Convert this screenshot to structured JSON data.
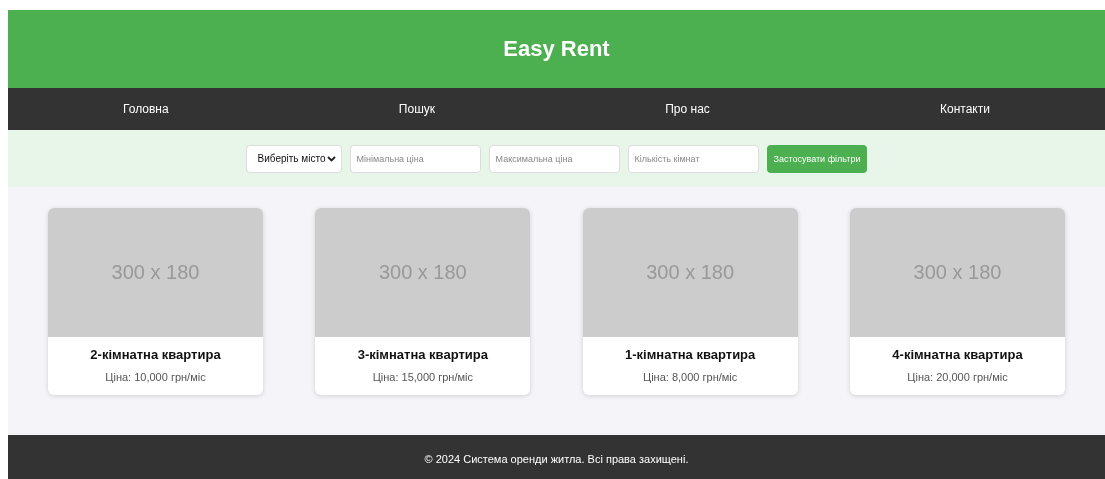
{
  "header": {
    "title": "Easy Rent"
  },
  "nav": [
    {
      "label": "Головна"
    },
    {
      "label": "Пошук"
    },
    {
      "label": "Про нас"
    },
    {
      "label": "Контакти"
    }
  ],
  "filters": {
    "city": {
      "value": "Виберіть місто"
    },
    "inputs": [
      {
        "placeholder": "Мінімальна ціна"
      },
      {
        "placeholder": "Максимальна ціна"
      },
      {
        "placeholder": "Кількість кімнат"
      }
    ],
    "button": "Застосувати фільтри"
  },
  "listings": [
    {
      "image_label": "300 x 180",
      "title": "2-кімнатна квартира",
      "price": "Ціна: 10,000 грн/міс"
    },
    {
      "image_label": "300 x 180",
      "title": "3-кімнатна квартира",
      "price": "Ціна: 15,000 грн/міс"
    },
    {
      "image_label": "300 x 180",
      "title": "1-кімнатна квартира",
      "price": "Ціна: 8,000 грн/міс"
    },
    {
      "image_label": "300 x 180",
      "title": "4-кімнатна квартира",
      "price": "Ціна: 20,000 грн/міс"
    }
  ],
  "footer": {
    "text": "© 2024 Система оренди житла. Всі права захищені."
  }
}
